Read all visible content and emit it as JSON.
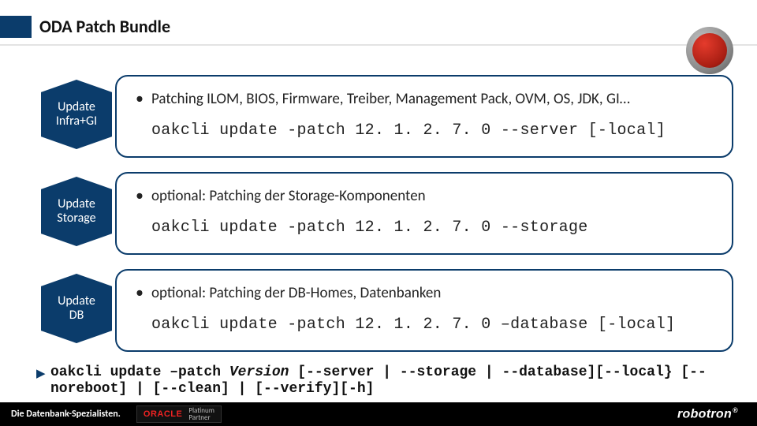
{
  "header": {
    "title": "ODA Patch Bundle"
  },
  "steps": [
    {
      "label": "Update\nInfra+GI",
      "bullet": "Patching ILOM, BIOS, Firmware, Treiber, Management Pack, OVM, OS, JDK, GI…",
      "cmd": "oakcli update -patch 12. 1. 2. 7. 0 --server [-local]"
    },
    {
      "label": "Update\nStorage",
      "bullet": "optional: Patching der Storage-Komponenten",
      "cmd": "oakcli update -patch 12. 1. 2. 7. 0 --storage"
    },
    {
      "label": "Update\nDB",
      "bullet": "optional: Patching der DB-Homes, Datenbanken",
      "cmd": "oakcli update -patch 12. 1. 2. 7. 0 –database [-local]"
    }
  ],
  "syntax": {
    "prefix": "oakcli update –patch ",
    "version": "Version",
    "rest": " [--server | --storage | --database][--local} [--noreboot] | [--clean] | [--verify][-h]"
  },
  "footer": {
    "tagline": "Die Datenbank-Spezialisten.",
    "oracle": "ORACLE",
    "oracle_sub": "Platinum\nPartner",
    "brand": "robotron"
  }
}
